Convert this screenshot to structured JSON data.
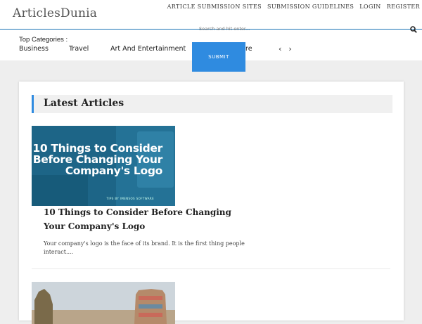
{
  "site": {
    "title": "ArticlesDunia"
  },
  "topnav": {
    "items": [
      "ARTICLE SUBMISSION SITES",
      "SUBMISSION GUIDELINES",
      "LOGIN",
      "REGISTER"
    ]
  },
  "search": {
    "placeholder": "Search and hit enter...",
    "submit_label": "SUBMIT"
  },
  "categories": {
    "title": "Top Categories :",
    "items": [
      "Business",
      "Travel",
      "Art And Entertainment",
      "re"
    ]
  },
  "latest": {
    "heading": "Latest Articles",
    "articles": [
      {
        "image_text": "10 Things to Consider Before Changing Your Company's Logo",
        "image_credit": "TIPS BY IMENSOS SOFTWARE",
        "title": "10 Things to Consider Before Changing Your Company's Logo",
        "excerpt": "Your company's logo is the face of its brand. It is the first thing people interact...."
      }
    ]
  },
  "colors": {
    "accent": "#2f8be0",
    "divider": "#1a73b5"
  }
}
